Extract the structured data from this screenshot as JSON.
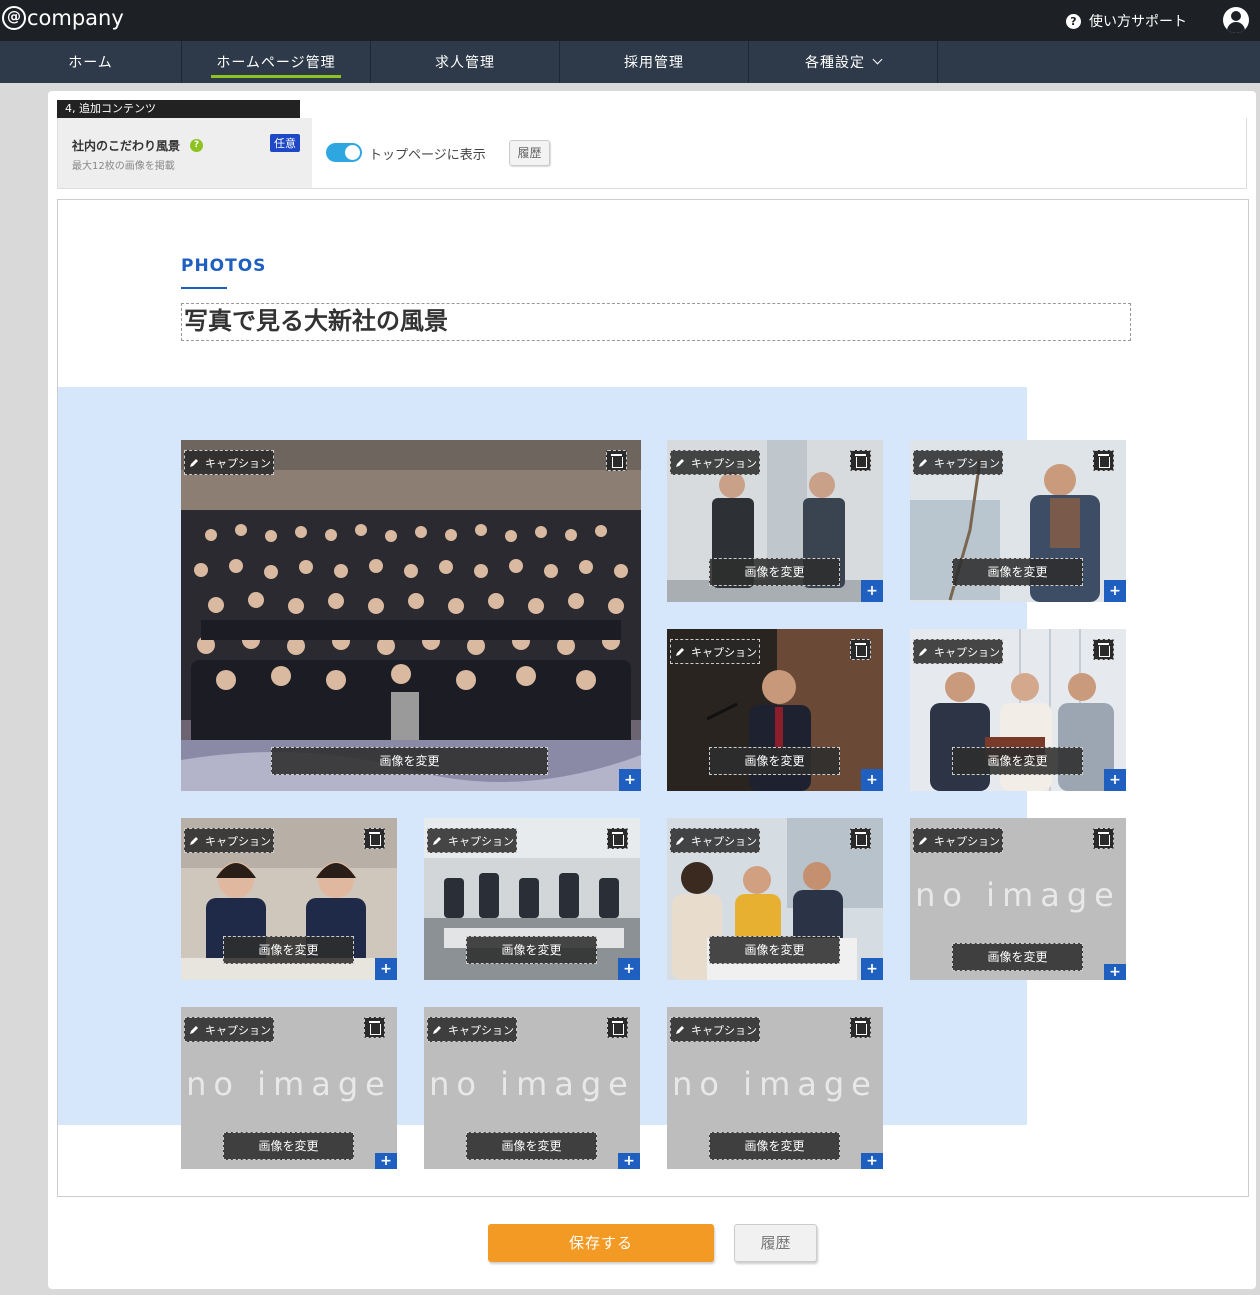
{
  "header": {
    "logo": "company",
    "support_label": "使い方サポート"
  },
  "nav": {
    "items": [
      {
        "label": "ホーム"
      },
      {
        "label": "ホームページ管理"
      },
      {
        "label": "求人管理"
      },
      {
        "label": "採用管理"
      },
      {
        "label": "各種設定"
      }
    ],
    "active_index": 1
  },
  "section": {
    "tag": "4, 追加コンテンツ",
    "title": "社内のこだわり風景",
    "subtitle": "最大12枚の画像を掲載",
    "badge": "任意",
    "toggle_label": "トップページに表示",
    "toggle_on": true,
    "history_label": "履歴"
  },
  "preview": {
    "label": "PHOTOS",
    "heading": "写真で見る大新社の風景",
    "caption_label": "キャプション",
    "change_label": "画像を変更",
    "no_image_text": "no image",
    "plus_label": "+"
  },
  "photos": [
    {
      "slot": 1,
      "has_image": true,
      "scene": "group-photo"
    },
    {
      "slot": 2,
      "has_image": true,
      "scene": "two-men-talking"
    },
    {
      "slot": 3,
      "has_image": true,
      "scene": "man-on-phone"
    },
    {
      "slot": 4,
      "has_image": true,
      "scene": "man-speaking-at-podium"
    },
    {
      "slot": 5,
      "has_image": true,
      "scene": "team-reading-document"
    },
    {
      "slot": 6,
      "has_image": true,
      "scene": "two-women-at-desk"
    },
    {
      "slot": 7,
      "has_image": true,
      "scene": "meeting-room"
    },
    {
      "slot": 8,
      "has_image": true,
      "scene": "team-discussion"
    },
    {
      "slot": 9,
      "has_image": false
    },
    {
      "slot": 10,
      "has_image": false
    },
    {
      "slot": 11,
      "has_image": false
    },
    {
      "slot": 12,
      "has_image": false
    }
  ],
  "footer": {
    "save_label": "保存する",
    "history_label": "履歴"
  },
  "colors": {
    "accent_blue": "#1f5fbf",
    "save_orange": "#f39a24",
    "nav_active_green": "#8dc21f",
    "toggle_blue": "#2ea7e0"
  }
}
